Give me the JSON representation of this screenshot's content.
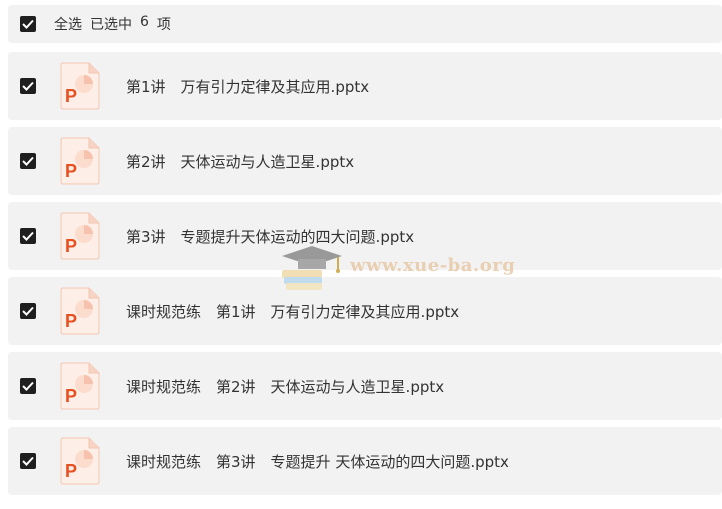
{
  "header": {
    "select_all": "全选",
    "selected_prefix": "已选中",
    "selected_count": "6",
    "selected_suffix": "项"
  },
  "files": [
    {
      "name": "第1讲　万有引力定律及其应用.pptx",
      "icon": "ppt-file-icon",
      "checked": true
    },
    {
      "name": "第2讲　天体运动与人造卫星.pptx",
      "icon": "ppt-file-icon",
      "checked": true
    },
    {
      "name": "第3讲　专题提升天体运动的四大问题.pptx",
      "icon": "ppt-file-icon",
      "checked": true
    },
    {
      "name": "课时规范练　第1讲　万有引力定律及其应用.pptx",
      "icon": "ppt-file-icon",
      "checked": true
    },
    {
      "name": "课时规范练　第2讲　天体运动与人造卫星.pptx",
      "icon": "ppt-file-icon",
      "checked": true
    },
    {
      "name": "课时规范练　第3讲　专题提升 天体运动的四大问题.pptx",
      "icon": "ppt-file-icon",
      "checked": true
    }
  ],
  "watermark": {
    "text": "www.xue-ba.org"
  },
  "colors": {
    "row_bg": "#f2f2f2",
    "checkbox": "#1f1f1f",
    "ppt_accent": "#e8501f",
    "ppt_bg": "#fdeee7"
  }
}
